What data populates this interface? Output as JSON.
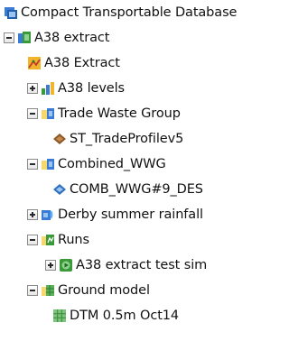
{
  "tree": {
    "root": {
      "label": "Compact Transportable Database",
      "icon": "database-icon"
    },
    "a38_extract_group": {
      "label": "A38 extract",
      "icon": "network-group-icon",
      "state": "expanded"
    },
    "a38_extract_item": {
      "label": "A38 Extract",
      "icon": "network-model-icon"
    },
    "a38_levels": {
      "label": "A38 levels",
      "icon": "levels-icon",
      "state": "collapsed"
    },
    "trade_waste_group": {
      "label": "Trade Waste Group",
      "icon": "folder-group-icon",
      "state": "expanded"
    },
    "trade_profile": {
      "label": "ST_TradeProfilev5",
      "icon": "trade-profile-icon"
    },
    "combined_wwg": {
      "label": "Combined_WWG",
      "icon": "folder-group-icon",
      "state": "expanded"
    },
    "comb_wwg_des": {
      "label": "COMB_WWG#9_DES",
      "icon": "wastewater-icon"
    },
    "derby_rainfall": {
      "label": "Derby summer rainfall",
      "icon": "rainfall-group-icon",
      "state": "collapsed"
    },
    "runs": {
      "label": "Runs",
      "icon": "runs-group-icon",
      "state": "expanded"
    },
    "a38_sim": {
      "label": "A38 extract test sim",
      "icon": "simulation-icon",
      "state": "collapsed"
    },
    "ground_model_group": {
      "label": "Ground model",
      "icon": "ground-model-group-icon",
      "state": "expanded"
    },
    "dtm": {
      "label": "DTM 0.5m Oct14",
      "icon": "grid-model-icon"
    }
  },
  "colors": {
    "text": "#111111",
    "toggle_border": "#8a8a8a",
    "group_green": "#3a9a3a",
    "group_blue": "#3a7bd5",
    "brown": "#8b5a2b",
    "grid_green": "#58b058"
  }
}
